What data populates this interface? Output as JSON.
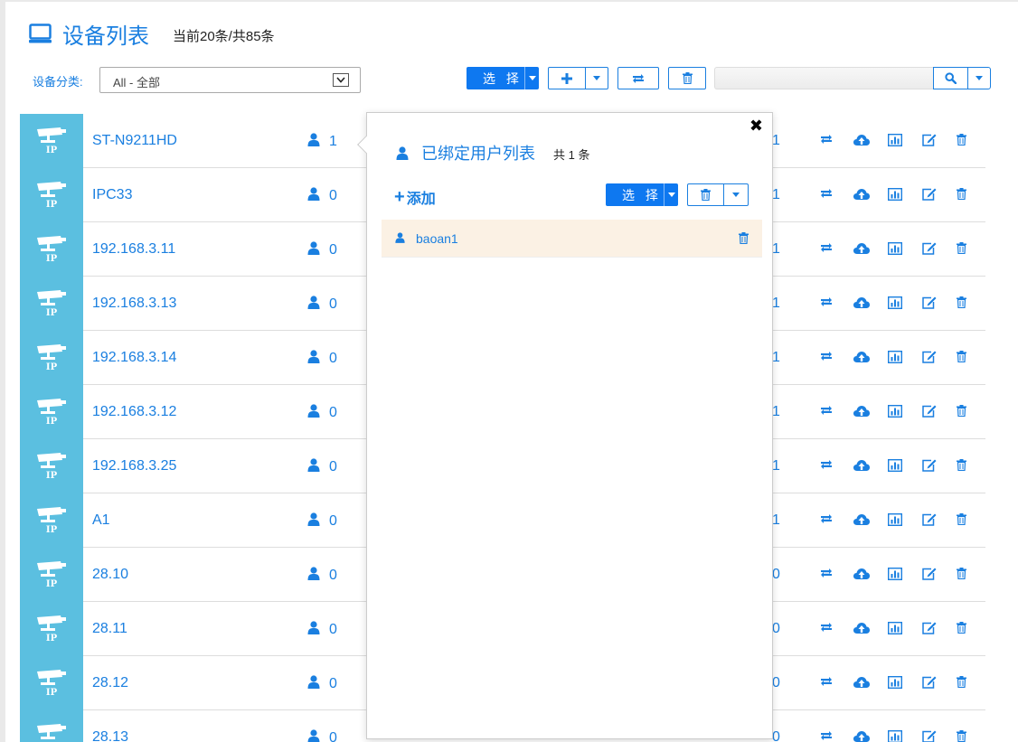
{
  "header": {
    "title": "设备列表",
    "count_text": "当前20条/共85条"
  },
  "filter": {
    "label": "设备分类:",
    "selected": "All - 全部"
  },
  "toolbar": {
    "select_label": "选 择",
    "search_value": ""
  },
  "device_badge": "IP",
  "devices": [
    {
      "name": "ST-N9211HD",
      "users": "1",
      "col2": "1"
    },
    {
      "name": "IPC33",
      "users": "0",
      "col2": "1"
    },
    {
      "name": "192.168.3.11",
      "users": "0",
      "col2": "1"
    },
    {
      "name": "192.168.3.13",
      "users": "0",
      "col2": "1"
    },
    {
      "name": "192.168.3.14",
      "users": "0",
      "col2": "1"
    },
    {
      "name": "192.168.3.12",
      "users": "0",
      "col2": "1"
    },
    {
      "name": "192.168.3.25",
      "users": "0",
      "col2": "1"
    },
    {
      "name": "A1",
      "users": "0",
      "col2": "1"
    },
    {
      "name": "28.10",
      "users": "0",
      "col2": "0"
    },
    {
      "name": "28.11",
      "users": "0",
      "col2": "0"
    },
    {
      "name": "28.12",
      "users": "0",
      "col2": "0"
    },
    {
      "name": "28.13",
      "users": "0",
      "col2": "0"
    }
  ],
  "popover": {
    "close": "✖",
    "title": "已绑定用户列表",
    "count": "共 1 条",
    "add_label": "添加",
    "select_label": "选 择",
    "users": [
      {
        "name": "baoan1"
      }
    ]
  },
  "colors": {
    "accent": "#1a7fe0",
    "primary_button": "#0e78f0",
    "ip_badge": "#5bbfe0",
    "highlight_row": "#fbf1e4"
  },
  "icons": [
    "monitor-icon",
    "user-icon",
    "camera-icon",
    "plus-icon",
    "retweet-icon",
    "trash-icon",
    "search-icon",
    "upload-cloud-icon",
    "bar-chart-icon",
    "edit-icon",
    "close-icon",
    "chevron-down-icon"
  ]
}
